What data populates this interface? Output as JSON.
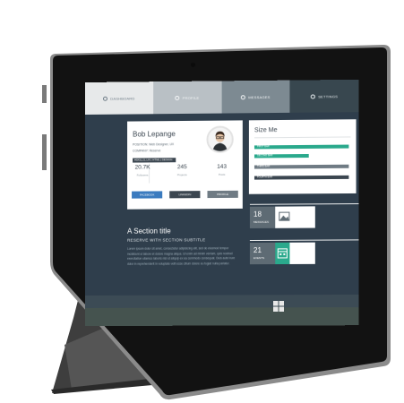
{
  "device": {
    "colors": {
      "bezel": "#141414",
      "frame": "#6f6f6f",
      "stand": "#4a4a4a",
      "screen_bg": "#2f3e4c"
    }
  },
  "nav": {
    "tabs": [
      {
        "label": "DASHBOARD",
        "icon": "dashboard-icon"
      },
      {
        "label": "PROFILE",
        "icon": "user-icon"
      },
      {
        "label": "MESSAGES",
        "icon": "mail-icon"
      },
      {
        "label": "SETTINGS",
        "icon": "gear-icon"
      }
    ]
  },
  "profile": {
    "name": "Bob Lepange",
    "position_line": "POSITION: Web Designer, UX",
    "company_line": "COMPANY: Reserve",
    "badge": "#SKILLS_UX | HTML | DESIGN",
    "stats": [
      {
        "value": "20.7K",
        "label": "Followers"
      },
      {
        "value": "245",
        "label": "Projects"
      },
      {
        "value": "143",
        "label": "Posts"
      }
    ],
    "buttons": [
      "FACEBOOK",
      "LINKEDIN",
      "PROFILE"
    ]
  },
  "sizeme": {
    "title": "Size Me",
    "bars": [
      "FIRST BAR",
      "SECOND BAR",
      "THIRD BAR",
      "FOURTH BAR"
    ]
  },
  "section": {
    "title": "A Section title",
    "subtitle": "RESERVE WITH SECTION SUBTITLE",
    "paragraph": "Lorem ipsum dolor sit amet, consectetur adipisicing elit, sed do eiusmod tempor incididunt ut labore et dolore magna aliqua. Ut enim ad minim veniam, quis nostrud exercitation ullamco laboris nisi ut aliquip ex ea commodo consequat. Duis aute irure dolor in reprehenderit in voluptate velit esse cillum dolore eu fugiat nulla pariatur."
  },
  "tiles": [
    {
      "number": "18",
      "caption": "MESSAGES",
      "icon": "image-icon",
      "accent": "#5e6b74"
    },
    {
      "number": "21",
      "caption": "EVENTS",
      "icon": "calendar-icon",
      "accent": "#2aa98c"
    }
  ],
  "windows_button": {
    "icon": "windows-logo-icon"
  }
}
